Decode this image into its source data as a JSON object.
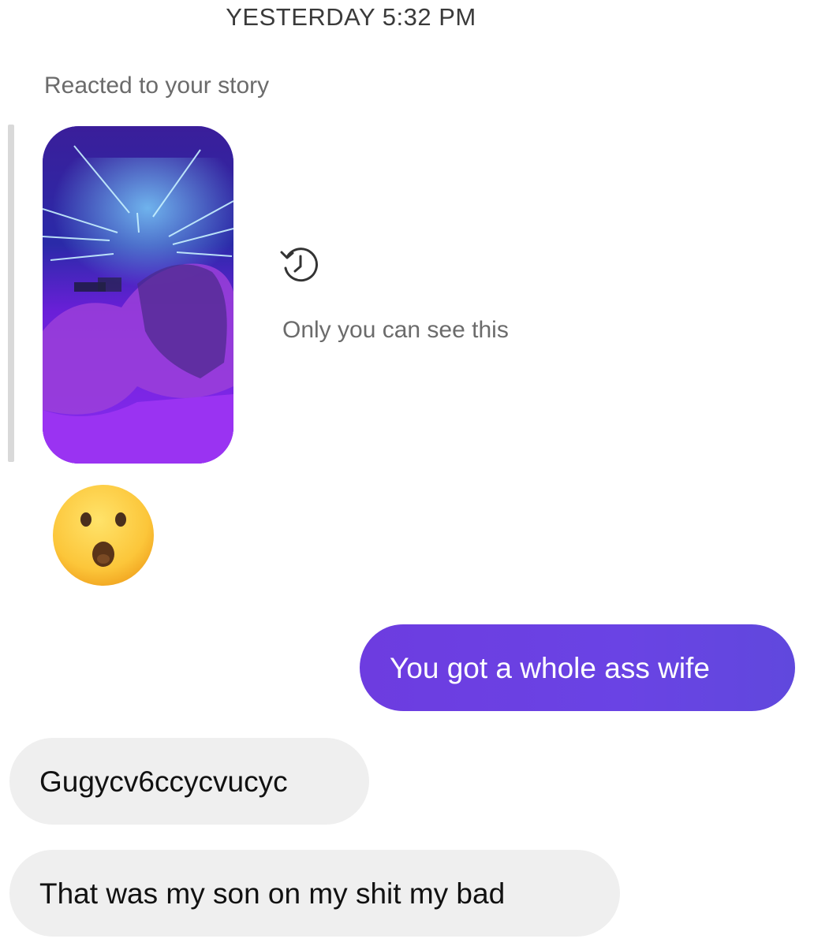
{
  "conversation": {
    "timestamp": "YESTERDAY 5:32 PM",
    "story_reply": {
      "header": "Reacted to your story",
      "visibility_note": "Only you can see this",
      "visibility_icon": "history-icon",
      "reaction": "😮"
    },
    "messages": [
      {
        "direction": "outgoing",
        "text": "You got a whole ass wife"
      },
      {
        "direction": "incoming",
        "text": "Gugycv6ccycvucyc"
      },
      {
        "direction": "incoming",
        "text": "That was my son on my shit my bad"
      }
    ]
  },
  "colors": {
    "outgoing_bubble": "#6a43e4",
    "incoming_bubble": "#efefef",
    "secondary_text": "#6b6b6b"
  }
}
